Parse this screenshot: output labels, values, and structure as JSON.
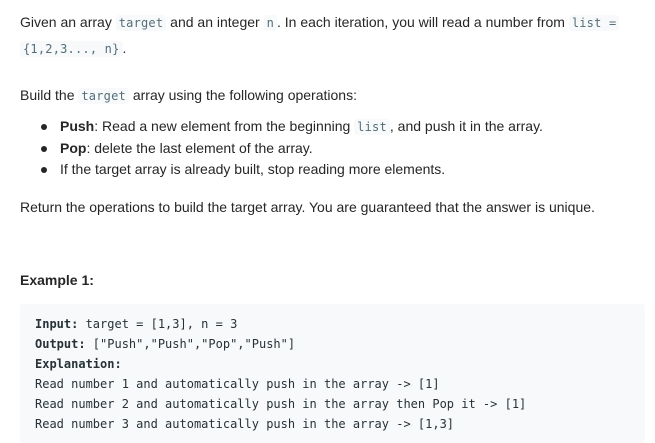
{
  "intro": {
    "t1": "Given an array ",
    "code1": "target",
    "t2": " and an integer ",
    "code2": "n",
    "t3": ". In each iteration, you will read a number from ",
    "code3": "list =",
    "code4": "{1,2,3..., n}",
    "t4": "."
  },
  "build": {
    "t1": "Build the ",
    "code1": "target",
    "t2": " array using the following operations:"
  },
  "bullets": [
    {
      "bold": "Push",
      "t1": ": Read a new element from the beginning ",
      "code": "list",
      "t2": ", and push it in the array."
    },
    {
      "bold": "Pop",
      "t1": ": delete the last element of the array."
    },
    {
      "t1": "If the target array is already built, stop reading more elements."
    }
  ],
  "return_text": "Return the operations to build the target array. You are guaranteed that the answer is unique.",
  "example": {
    "title": "Example 1:",
    "input_label": "Input:",
    "input_value": " target = [1,3], n = 3",
    "output_label": "Output:",
    "output_value": " [\"Push\",\"Push\",\"Pop\",\"Push\"]",
    "explanation_label": "Explanation:",
    "lines": [
      "Read number 1 and automatically push in the array -> [1]",
      "Read number 2 and automatically push in the array then Pop it -> [1]",
      "Read number 3 and automatically push in the array -> [1,3]"
    ]
  }
}
